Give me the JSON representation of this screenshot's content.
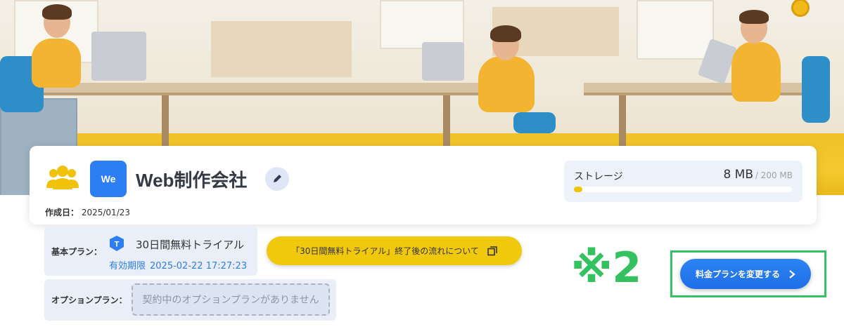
{
  "colors": {
    "accent_blue": "#2c7ef2",
    "yellow": "#f1c90c",
    "annotation_green": "#36c262",
    "panel_bg": "#e9eef8"
  },
  "banner": {
    "icon": "office-illustration"
  },
  "company": {
    "avatar_initials": "We",
    "name": "Web制作会社",
    "group_icon": "group-icon",
    "edit_icon": "pencil-icon",
    "created_label": "作成日：",
    "created_date": "2025/01/23"
  },
  "storage": {
    "label": "ストレージ",
    "used": "8 MB",
    "total": "/ 200 MB",
    "fill_fraction": 0.04
  },
  "plan": {
    "basic_label": "基本プラン：",
    "badge_letter": "T",
    "name": "30日間無料トライアル",
    "expiry_label": "有効期限",
    "expiry_value": "2025-02-22 17:27:23",
    "info_button": "「30日間無料トライアル」終了後の流れについて",
    "info_icon": "copy-icon",
    "option_label": "オプションプラン：",
    "option_empty": "契約中のオプションプランがありません"
  },
  "annotation": {
    "text": "※2"
  },
  "change_plan": {
    "label": "料金プランを変更する",
    "icon": "chevron-right-icon"
  }
}
